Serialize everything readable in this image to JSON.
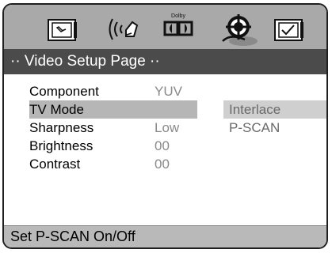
{
  "toolbar": {
    "icons": [
      "general-setup-icon",
      "audio-setup-icon",
      "dolby-setup-icon",
      "video-setup-icon",
      "preference-setup-icon"
    ],
    "dolby_label": "Dolby",
    "active_icon": "video-setup-icon"
  },
  "page": {
    "title": "·· Video Setup Page ··"
  },
  "menu": {
    "items": [
      {
        "label": "Component",
        "value": "YUV",
        "selected": false
      },
      {
        "label": "TV Mode",
        "value": "",
        "selected": true
      },
      {
        "label": "Sharpness",
        "value": "Low",
        "selected": false
      },
      {
        "label": "Brightness",
        "value": "00",
        "selected": false
      },
      {
        "label": "Contrast",
        "value": "00",
        "selected": false
      }
    ]
  },
  "submenu": {
    "options": [
      {
        "label": "Interlace",
        "selected": true
      },
      {
        "label": "P-SCAN",
        "selected": false
      }
    ]
  },
  "status": {
    "text": "Set P-SCAN On/Off"
  },
  "colors": {
    "toolbar_bg": "#a9a9a9",
    "title_bg": "#4b4b4b",
    "selected_row": "#b6b6b6",
    "status_bg": "#b9b9b9"
  }
}
